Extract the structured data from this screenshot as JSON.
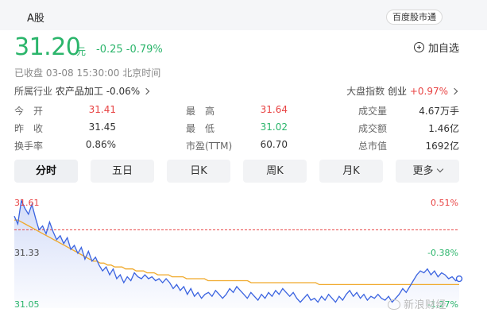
{
  "header": {
    "market_tab": "A股",
    "source_badge": "百度股市通"
  },
  "quote": {
    "price": "31.20",
    "unit": "元",
    "change": "-0.25 -0.79%",
    "watch_label": "加自选",
    "status": "已收盘  03-08 15:30:00  北京时间"
  },
  "industry": {
    "label": "所属行业",
    "name": "农产品加工",
    "change": "-0.06%"
  },
  "market_index": {
    "label": "大盘指数",
    "name": "创业",
    "change": "+0.97%"
  },
  "stats": [
    {
      "label": "今　开",
      "value": "31.41"
    },
    {
      "label": "最　高",
      "value": "31.64"
    },
    {
      "label": "成交量",
      "value": "4.67万手"
    },
    {
      "label": "昨　收",
      "value": "31.45"
    },
    {
      "label": "最　低",
      "value": "31.02"
    },
    {
      "label": "成交额",
      "value": "1.46亿"
    },
    {
      "label": "换手率",
      "value": "0.86%"
    },
    {
      "label": "市盈(TTM)",
      "value": "60.70"
    },
    {
      "label": "总市值",
      "value": "1692亿"
    }
  ],
  "tabs": [
    "分时",
    "五日",
    "日K",
    "周K",
    "月K",
    "更多"
  ],
  "colors": {
    "down": "#2bb56b",
    "up": "#e84343",
    "price_line": "#3a63e0",
    "avg_line": "#f0a92a"
  },
  "chart_data": {
    "type": "line",
    "y_labels_left": [
      "31.61",
      "31.33",
      "31.05"
    ],
    "y_labels_right": [
      "0.51%",
      "-0.38%",
      "-1.27%"
    ],
    "ylim": [
      31.05,
      31.61
    ],
    "reference": 31.45,
    "series": [
      {
        "values": [
          31.52,
          31.48,
          31.6,
          31.56,
          31.53,
          31.58,
          31.51,
          31.45,
          31.47,
          31.43,
          31.49,
          31.44,
          31.4,
          31.42,
          31.38,
          31.41,
          31.35,
          31.37,
          31.33,
          31.36,
          31.3,
          31.34,
          31.29,
          31.31,
          31.27,
          31.24,
          31.26,
          31.22,
          31.25,
          31.2,
          31.22,
          31.18,
          31.21,
          31.19,
          31.23,
          31.21,
          31.2,
          31.22,
          31.2,
          31.21,
          31.19,
          31.2,
          31.18,
          31.2,
          31.18,
          31.15,
          31.17,
          31.14,
          31.16,
          31.12,
          31.15,
          31.11,
          31.13,
          31.1,
          31.12,
          31.13,
          31.11,
          31.14,
          31.12,
          31.1,
          31.12,
          31.15,
          31.13,
          31.16,
          31.14,
          31.12,
          31.1,
          31.13,
          31.11,
          31.09,
          31.12,
          31.1,
          31.13,
          31.11,
          31.14,
          31.12,
          31.15,
          31.13,
          31.11,
          31.13,
          31.1,
          31.08,
          31.1,
          31.12,
          31.09,
          31.1,
          31.08,
          31.11,
          31.09,
          31.12,
          31.1,
          31.08,
          31.11,
          31.09,
          31.12,
          31.14,
          31.11,
          31.13,
          31.1,
          31.12,
          31.09,
          31.11,
          31.1,
          31.12,
          31.1,
          31.09,
          31.11,
          31.08,
          31.1,
          31.12,
          31.15,
          31.13,
          31.16,
          31.19,
          31.22,
          31.24,
          31.23,
          31.25,
          31.22,
          31.24,
          31.21,
          31.23,
          31.22,
          31.2,
          31.21,
          31.19,
          31.2
        ]
      },
      {
        "values": [
          31.5,
          31.5,
          31.49,
          31.48,
          31.47,
          31.46,
          31.45,
          31.44,
          31.43,
          31.42,
          31.41,
          31.4,
          31.39,
          31.38,
          31.37,
          31.36,
          31.35,
          31.34,
          31.33,
          31.32,
          31.31,
          31.3,
          31.29,
          31.29,
          31.28,
          31.28,
          31.27,
          31.27,
          31.26,
          31.26,
          31.26,
          31.25,
          31.25,
          31.25,
          31.24,
          31.24,
          31.24,
          31.23,
          31.23,
          31.23,
          31.22,
          31.22,
          31.22,
          31.22,
          31.21,
          31.21,
          31.21,
          31.21,
          31.2,
          31.2,
          31.2,
          31.2,
          31.2,
          31.2,
          31.19,
          31.19,
          31.19,
          31.19,
          31.19,
          31.19,
          31.19,
          31.19,
          31.19,
          31.19,
          31.19,
          31.19,
          31.18,
          31.18,
          31.18,
          31.18,
          31.18,
          31.18,
          31.18,
          31.18,
          31.18,
          31.18,
          31.18,
          31.18,
          31.18,
          31.18,
          31.18,
          31.18,
          31.18,
          31.18,
          31.18,
          31.17,
          31.17,
          31.17,
          31.17,
          31.17,
          31.17,
          31.17,
          31.17,
          31.17,
          31.17,
          31.17,
          31.17,
          31.17,
          31.17,
          31.17,
          31.17,
          31.17,
          31.17,
          31.17,
          31.17,
          31.17,
          31.17,
          31.17,
          31.17,
          31.17,
          31.17,
          31.17,
          31.17,
          31.17,
          31.17,
          31.17,
          31.17,
          31.17,
          31.17,
          31.17,
          31.17,
          31.17,
          31.17,
          31.17,
          31.17
        ]
      }
    ]
  },
  "watermark": "新浪财经"
}
